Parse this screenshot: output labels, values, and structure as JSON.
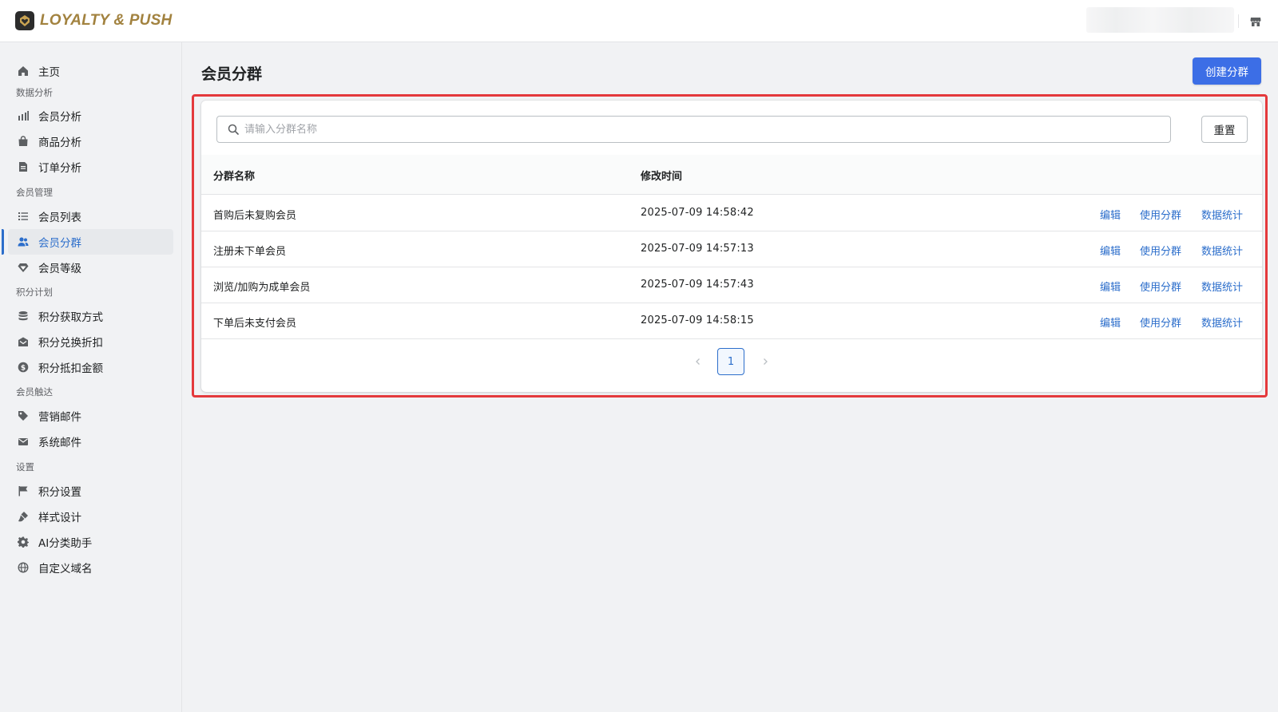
{
  "app": {
    "brand": "LOYALTY & PUSH",
    "accent": "#2c6ecb",
    "primary_button_color": "#3c6ee6",
    "highlight_color": "#e4393c"
  },
  "sidebar": {
    "home": {
      "label": "主页",
      "icon": "home-icon"
    },
    "sections": [
      {
        "title": "数据分析",
        "items": [
          {
            "label": "会员分析",
            "icon": "bar-chart-icon"
          },
          {
            "label": "商品分析",
            "icon": "shopping-bag-icon"
          },
          {
            "label": "订单分析",
            "icon": "document-icon"
          }
        ]
      },
      {
        "title": "会员管理",
        "items": [
          {
            "label": "会员列表",
            "icon": "list-icon"
          },
          {
            "label": "会员分群",
            "icon": "users-icon",
            "active": true
          },
          {
            "label": "会员等级",
            "icon": "diamond-icon"
          }
        ]
      },
      {
        "title": "积分计划",
        "items": [
          {
            "label": "积分获取方式",
            "icon": "database-stack-icon"
          },
          {
            "label": "积分兑换折扣",
            "icon": "discount-mail-icon"
          },
          {
            "label": "积分抵扣金额",
            "icon": "dollar-circle-icon"
          }
        ]
      },
      {
        "title": "会员触达",
        "items": [
          {
            "label": "营销邮件",
            "icon": "tag-icon"
          },
          {
            "label": "系统邮件",
            "icon": "envelope-icon"
          }
        ]
      },
      {
        "title": "设置",
        "items": [
          {
            "label": "积分设置",
            "icon": "flag-icon"
          },
          {
            "label": "样式设计",
            "icon": "paint-brush-icon"
          },
          {
            "label": "AI分类助手",
            "icon": "gear-icon"
          },
          {
            "label": "自定义域名",
            "icon": "globe-icon"
          }
        ]
      }
    ]
  },
  "header": {
    "title": "会员分群",
    "create_button": "创建分群"
  },
  "search": {
    "placeholder": "请输入分群名称",
    "value": "",
    "reset_label": "重置"
  },
  "table": {
    "columns": [
      "分群名称",
      "修改时间"
    ],
    "actions": [
      "编辑",
      "使用分群",
      "数据统计"
    ],
    "rows": [
      {
        "name": "首购后未复购会员",
        "time": "2025-07-09 14:58:42"
      },
      {
        "name": "注册未下单会员",
        "time": "2025-07-09 14:57:13"
      },
      {
        "name": "浏览/加购为成单会员",
        "time": "2025-07-09 14:57:43"
      },
      {
        "name": "下单后未支付会员",
        "time": "2025-07-09 14:58:15"
      }
    ]
  },
  "pagination": {
    "current_page": "1"
  }
}
